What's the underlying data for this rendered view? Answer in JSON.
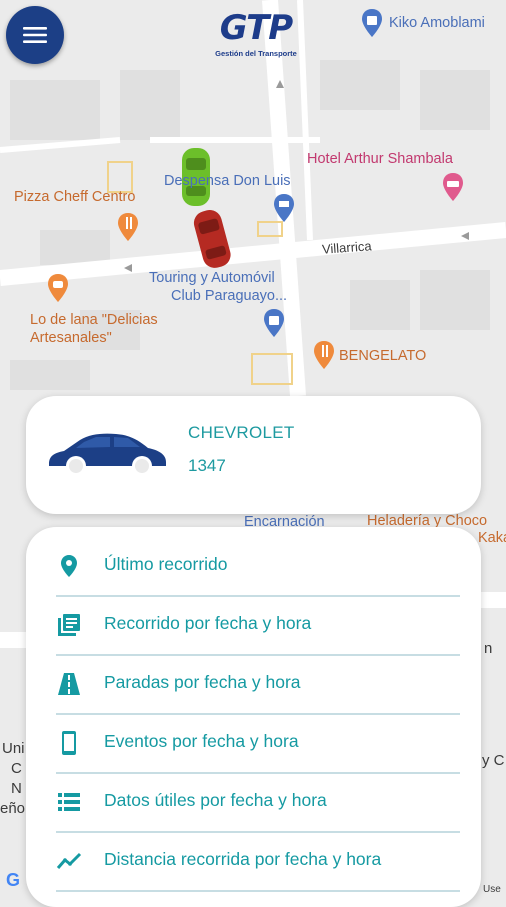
{
  "header": {
    "logo_text": "GTP",
    "logo_subtitle": "Gestión del Transporte"
  },
  "map": {
    "pois": {
      "kiko": "Kiko Amoblami",
      "hotel": "Hotel Arthur Shambala",
      "pizza": "Pizza Cheff Centro",
      "despensa": "Despensa Don Luis",
      "villarrica": "Villarrica",
      "touring_line1": "Touring y Automóvil",
      "touring_line2": "Club Paraguayo...",
      "lana_line1": "Lo de lana \"Delicias",
      "lana_line2": "Artesanales\"",
      "bengelato": "BENGELATO",
      "encarnacion": "Encarnación",
      "heladeria": "Heladería y Choco",
      "kakaw": "Kakav",
      "uni_1": "Uni",
      "uni_2": "C",
      "uni_3": "N",
      "uni_4": "eño",
      "right_1": "n",
      "right_2": "y C",
      "google_g": "G",
      "use_fragment": "Use"
    },
    "vehicle_colors": {
      "green": "#6cbf2a",
      "red": "#b52a22"
    }
  },
  "vehicle": {
    "brand": "CHEVROLET",
    "id": "1347"
  },
  "menu": {
    "items": [
      {
        "label": "Último recorrido",
        "icon": "location-pin-icon"
      },
      {
        "label": "Recorrido por fecha y hora",
        "icon": "library-books-icon"
      },
      {
        "label": "Paradas por fecha y hora",
        "icon": "road-icon"
      },
      {
        "label": "Eventos por fecha y hora",
        "icon": "smartphone-icon"
      },
      {
        "label": "Datos útiles por fecha y hora",
        "icon": "list-icon"
      },
      {
        "label": "Distancia recorrida por fecha y hora",
        "icon": "trending-line-icon"
      }
    ]
  },
  "colors": {
    "primary": "#1c3f86",
    "accent": "#159aa2",
    "divider": "#c7dde3"
  }
}
